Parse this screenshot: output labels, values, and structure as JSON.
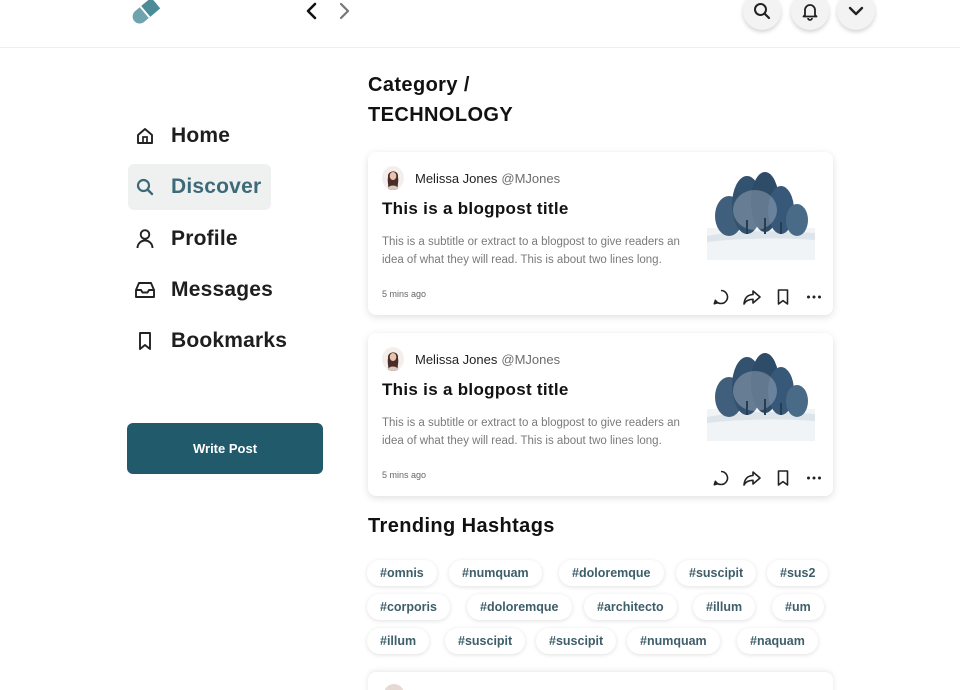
{
  "header": {
    "logo_icon": "pill-icon",
    "back_icon": "chevron-left-icon",
    "forward_icon": "chevron-right-icon",
    "search_icon": "search-icon",
    "notifications_icon": "bell-icon",
    "menu_icon": "chevron-down-icon"
  },
  "sidebar": {
    "items": [
      {
        "label": "Home",
        "icon": "home-icon"
      },
      {
        "label": "Discover",
        "icon": "search-icon",
        "active": true
      },
      {
        "label": "Profile",
        "icon": "user-icon"
      },
      {
        "label": "Messages",
        "icon": "inbox-icon"
      },
      {
        "label": "Bookmarks",
        "icon": "bookmark-icon"
      }
    ],
    "write_button": "Write Post"
  },
  "main": {
    "category_line1": "Category /",
    "category_line2": "TECHNOLOGY",
    "posts": [
      {
        "author": "Melissa Jones",
        "handle": "@MJones",
        "title": "This is a blogpost title",
        "subtitle": "This is a subtitle or extract to a blogpost to give readers an idea of what they will read. This is about two lines long.",
        "time": "5 mins ago",
        "actions": [
          "comment-icon",
          "share-icon",
          "bookmark-icon",
          "more-horizontal-icon"
        ]
      },
      {
        "author": "Melissa Jones",
        "handle": "@MJones",
        "title": "This is a blogpost title",
        "subtitle": "This is a subtitle or extract to a blogpost to give readers an idea of what they will read. This is about two lines long.",
        "time": "5 mins ago",
        "actions": [
          "comment-icon",
          "share-icon",
          "bookmark-icon",
          "more-horizontal-icon"
        ]
      }
    ],
    "trending_title": "Trending Hashtags",
    "hashtags": [
      "#omnis",
      "#numquam",
      "#doloremque",
      "#suscipit",
      "#sus2",
      "#corporis",
      "#doloremque",
      "#architecto",
      "#illum",
      "#um",
      "#illum",
      "#suscipit",
      "#suscipit",
      "#numquam",
      "#naquam"
    ]
  },
  "colors": {
    "accent": "#215a6b",
    "active_text": "#3d6a79",
    "hashtag_text": "#3e5e6a",
    "active_bg": "#eff1f1"
  }
}
